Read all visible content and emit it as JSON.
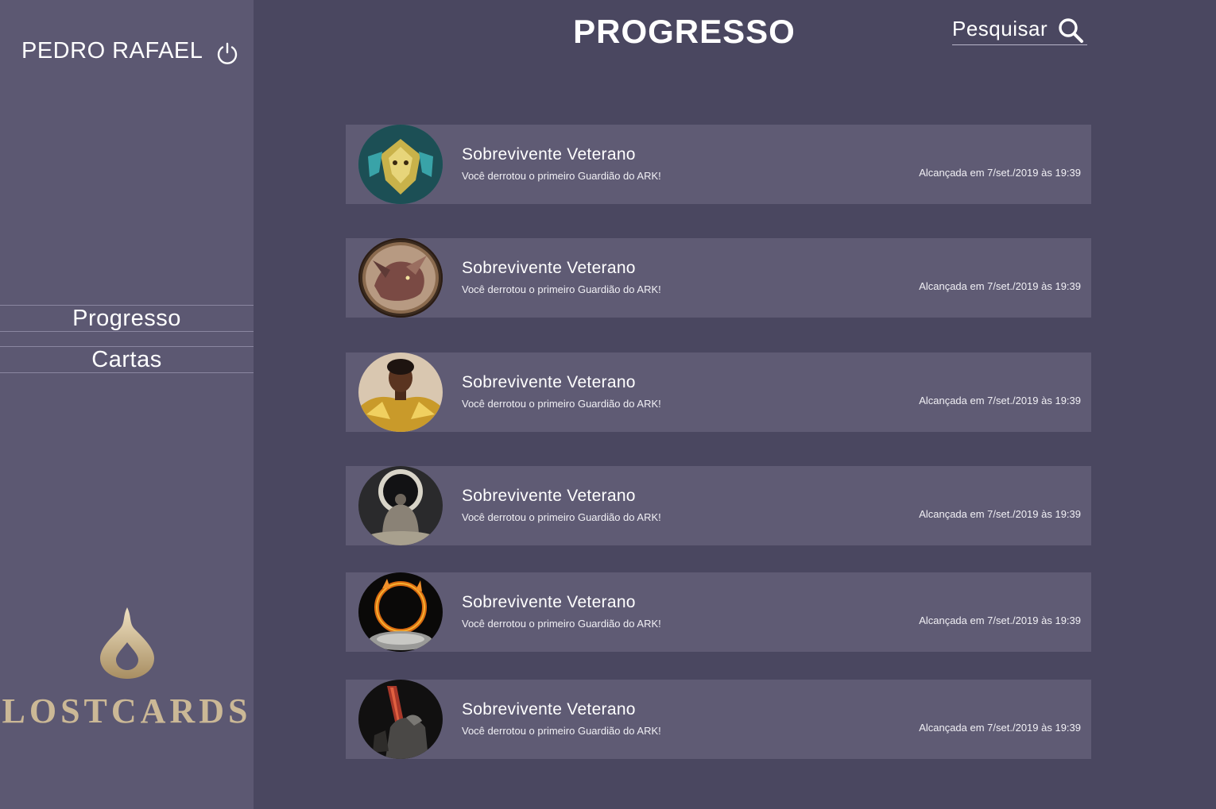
{
  "user": {
    "name": "PEDRO RAFAEL",
    "logout_icon": "power-icon"
  },
  "nav": {
    "items": [
      {
        "label": "Progresso"
      },
      {
        "label": "Cartas"
      }
    ]
  },
  "brand": {
    "logo_text": "LOSTCARDS",
    "logo_icon": "flame-drop-icon",
    "color": "#cbb896"
  },
  "header": {
    "title": "PROGRESSO"
  },
  "search": {
    "label": "Pesquisar",
    "icon": "search-icon"
  },
  "achievements": [
    {
      "title": "Sobrevivente Veterano",
      "description": "Você derrotou o primeiro Guardião do ARK!",
      "date": "Alcançada em 7/set./2019 às 19:39",
      "avatar_icon": "mask-avatar"
    },
    {
      "title": "Sobrevivente Veterano",
      "description": "Você derrotou o primeiro Guardião do ARK!",
      "date": "Alcançada em 7/set./2019 às 19:39",
      "avatar_icon": "dragon-avatar"
    },
    {
      "title": "Sobrevivente Veterano",
      "description": "Você derrotou o primeiro Guardião do ARK!",
      "date": "Alcançada em 7/set./2019 às 19:39",
      "avatar_icon": "golden-armor-avatar"
    },
    {
      "title": "Sobrevivente Veterano",
      "description": "Você derrotou o primeiro Guardião do ARK!",
      "date": "Alcançada em 7/set./2019 às 19:39",
      "avatar_icon": "eclipse-figure-avatar"
    },
    {
      "title": "Sobrevivente Veterano",
      "description": "Você derrotou o primeiro Guardião do ARK!",
      "date": "Alcançada em 7/set./2019 às 19:39",
      "avatar_icon": "fire-ring-avatar"
    },
    {
      "title": "Sobrevivente Veterano",
      "description": "Você derrotou o primeiro Guardião do ARK!",
      "date": "Alcançada em 7/set./2019 às 19:39",
      "avatar_icon": "knight-sword-avatar"
    }
  ]
}
